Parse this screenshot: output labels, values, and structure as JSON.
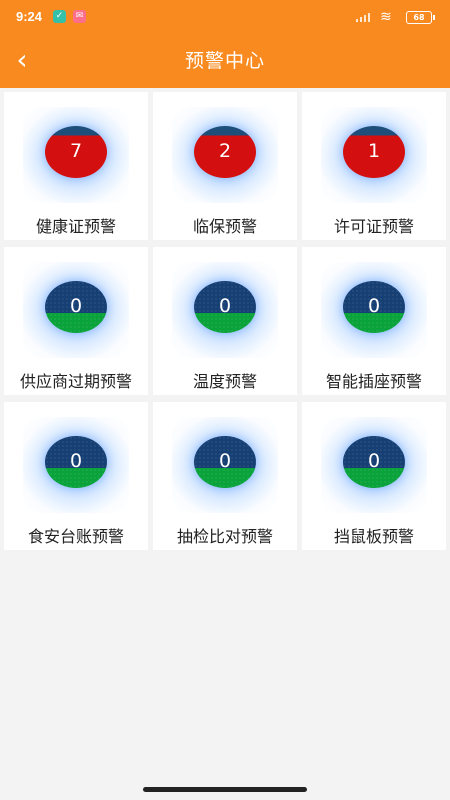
{
  "status_bar": {
    "time": "9:24",
    "battery": "68"
  },
  "header": {
    "title": "预警中心",
    "back_icon": "chevron-left-icon"
  },
  "cards": [
    {
      "label": "健康证预警",
      "count": "7",
      "status": "red"
    },
    {
      "label": "临保预警",
      "count": "2",
      "status": "red"
    },
    {
      "label": "许可证预警",
      "count": "1",
      "status": "red"
    },
    {
      "label": "供应商过期预警",
      "count": "0",
      "status": "green"
    },
    {
      "label": "温度预警",
      "count": "0",
      "status": "green"
    },
    {
      "label": "智能插座预警",
      "count": "0",
      "status": "green"
    },
    {
      "label": "食安台账预警",
      "count": "0",
      "status": "green"
    },
    {
      "label": "抽检比对预警",
      "count": "0",
      "status": "green"
    },
    {
      "label": "挡鼠板预警",
      "count": "0",
      "status": "green"
    }
  ],
  "colors": {
    "header_bg": "#f98a1f",
    "alert_red": "#d30f0f",
    "ok_green": "#0aa23a",
    "badge_blue": "#163f74"
  }
}
